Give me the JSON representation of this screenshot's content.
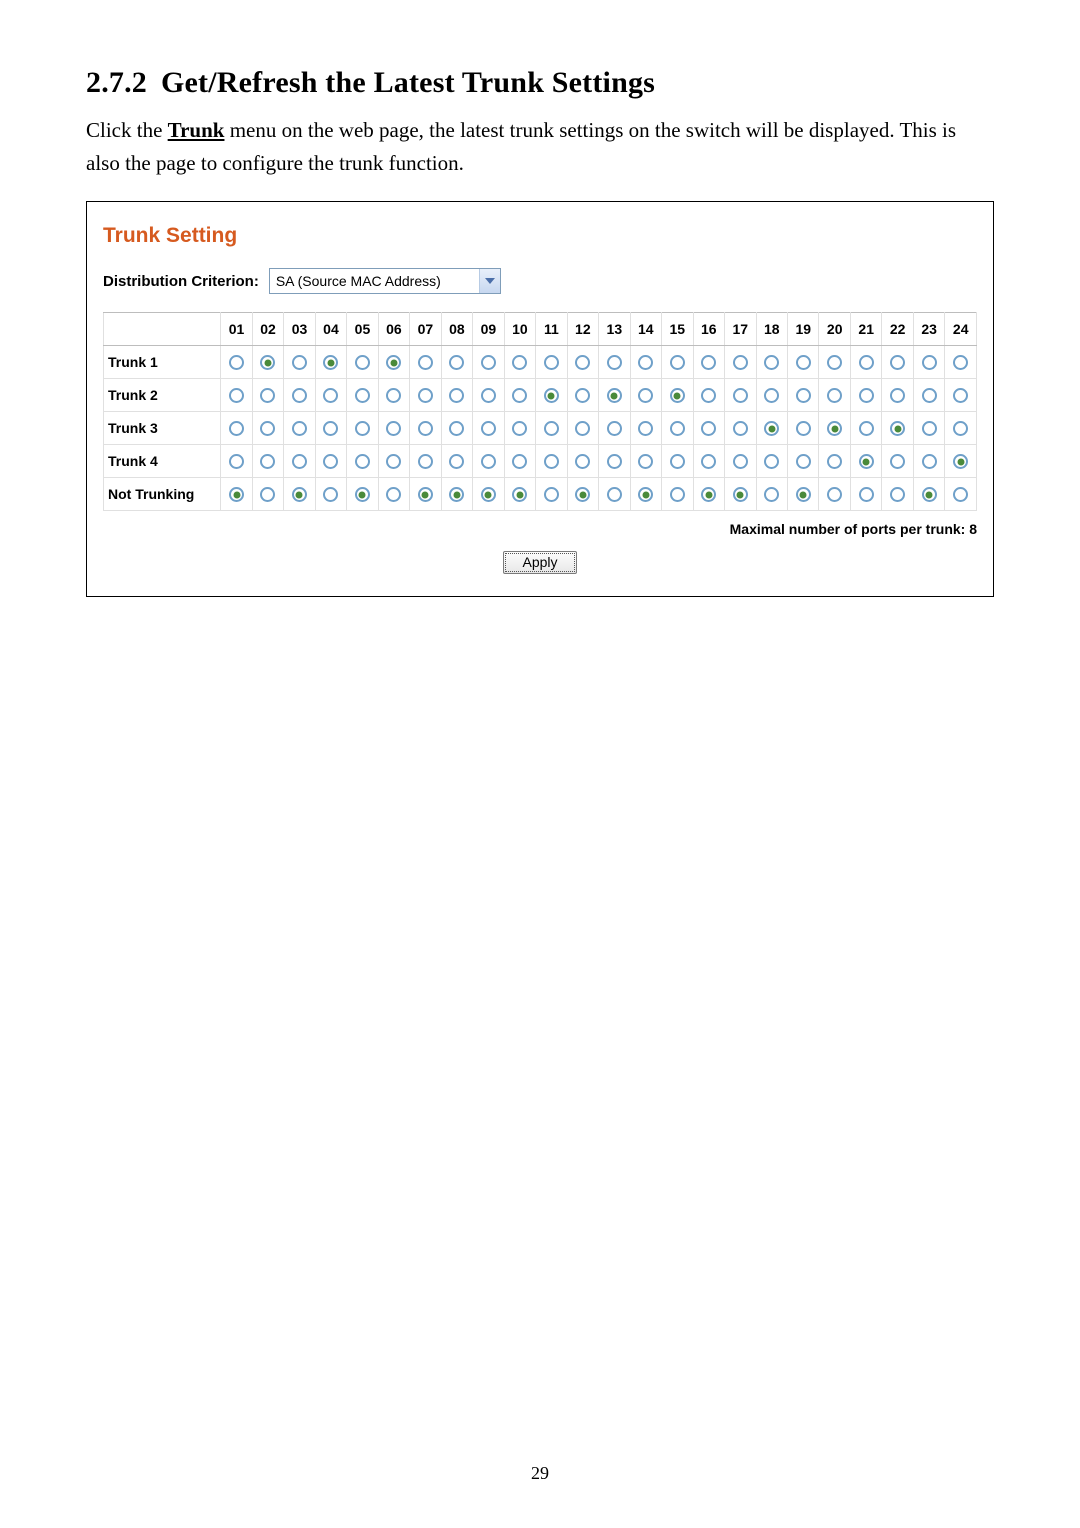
{
  "heading": {
    "number": "2.7.2",
    "title": "Get/Refresh the Latest Trunk Settings"
  },
  "paragraph": {
    "pre": "Click the ",
    "link": "Trunk",
    "post": " menu on the web page, the latest trunk settings on the switch will be displayed. This is also the page to configure the trunk function."
  },
  "panel": {
    "title": "Trunk Setting",
    "dist_label": "Distribution Criterion:",
    "dist_value": "SA (Source MAC Address)",
    "port_headers": [
      "01",
      "02",
      "03",
      "04",
      "05",
      "06",
      "07",
      "08",
      "09",
      "10",
      "11",
      "12",
      "13",
      "14",
      "15",
      "16",
      "17",
      "18",
      "19",
      "20",
      "21",
      "22",
      "23",
      "24"
    ],
    "rows": [
      {
        "label": "Trunk 1"
      },
      {
        "label": "Trunk 2"
      },
      {
        "label": "Trunk 3"
      },
      {
        "label": "Trunk 4"
      },
      {
        "label": "Not Trunking"
      }
    ],
    "port_assignment": [
      5,
      1,
      5,
      1,
      5,
      1,
      5,
      5,
      5,
      5,
      2,
      5,
      2,
      5,
      2,
      5,
      5,
      3,
      5,
      3,
      4,
      3,
      5,
      4
    ],
    "max_note": "Maximal number of ports per trunk: 8",
    "apply_label": "Apply"
  },
  "page_number": "29"
}
